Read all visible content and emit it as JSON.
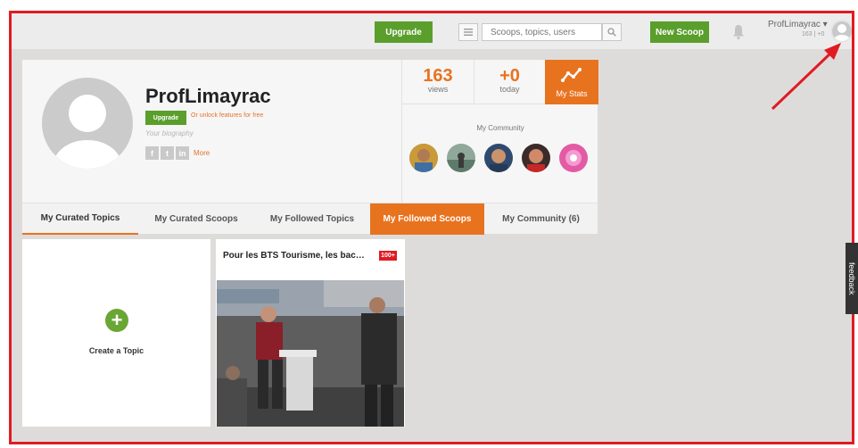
{
  "header": {
    "upgrade_label": "Upgrade",
    "search_placeholder": "Scoops, topics, users",
    "new_scoop_label": "New Scoop",
    "user_name": "ProfLimayrac ▾",
    "user_stats": "163 | +0"
  },
  "profile": {
    "name": "ProfLimayrac",
    "upgrade_label": "Upgrade",
    "unlock_text": "Or unlock features for free",
    "bio_placeholder": "Your biography",
    "social": [
      "f",
      "t",
      "in"
    ],
    "more_label": "More"
  },
  "stats": {
    "views_value": "163",
    "views_label": "views",
    "today_value": "+0",
    "today_label": "today",
    "mystats_label": "My Stats",
    "community_title": "My Community"
  },
  "tabs": [
    {
      "label": "My Curated Topics"
    },
    {
      "label": "My Curated Scoops"
    },
    {
      "label": "My Followed Topics"
    },
    {
      "label": "My Followed Scoops"
    },
    {
      "label": "My Community (6)"
    }
  ],
  "cards": {
    "create_label": "Create a Topic",
    "scoop_title": "Pour les BTS Tourisme, les bac…",
    "scoop_badge": "100+"
  },
  "feedback_label": "feedback",
  "colors": {
    "brand_green": "#5a9e2c",
    "accent_orange": "#e8731f",
    "highlight_red": "#e01b22"
  }
}
